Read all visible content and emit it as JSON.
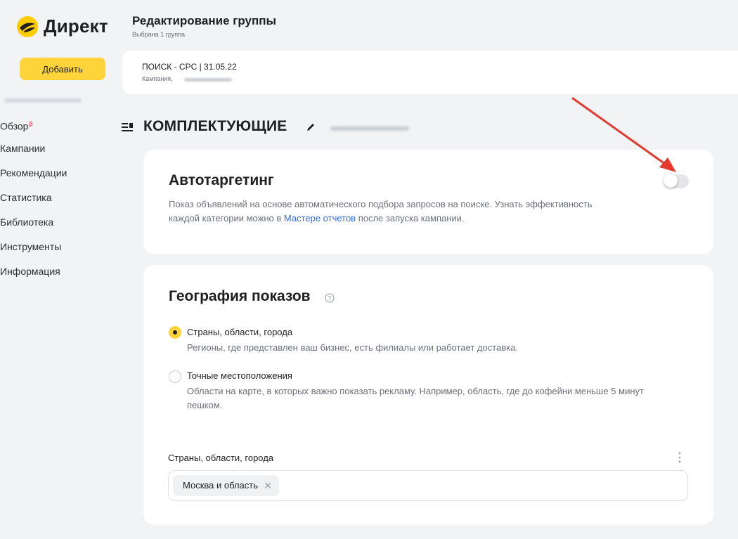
{
  "brand": {
    "name": "Директ",
    "accent": "#ffd43b",
    "logo_icon": "yandex-direct-logo-icon"
  },
  "sidebar": {
    "add_button": "Добавить",
    "items": [
      {
        "label": "Обзор",
        "badge": "β"
      },
      {
        "label": "Кампании"
      },
      {
        "label": "Рекомендации"
      },
      {
        "label": "Статистика"
      },
      {
        "label": "Библиотека"
      },
      {
        "label": "Инструменты"
      },
      {
        "label": "Информация"
      }
    ]
  },
  "header": {
    "title": "Редактирование группы",
    "subtitle": "Выбрана 1 группа"
  },
  "campaign": {
    "name": "ПОИСК - CPC | 31.05.22",
    "meta_label": "Кампания,"
  },
  "group": {
    "title": "КОМПЛЕКТУЮЩИЕ"
  },
  "autotargeting": {
    "title": "Автотаргетинг",
    "desc_part1": "Показ объявлений на основе автоматического подбора запросов на поиске. Узнать эффективность каждой категории можно в ",
    "link_text": "Мастере отчетов",
    "desc_part2": " после запуска кампании.",
    "enabled": false
  },
  "geography": {
    "title": "География показов",
    "options": [
      {
        "label": "Страны, области, города",
        "desc": "Регионы, где представлен ваш бизнес, есть филиалы или работает доставка.",
        "selected": true
      },
      {
        "label": "Точные местоположения",
        "desc": "Области на карте, в которых важно показать рекламу. Например, область, где до кофейни меньше 5 минут пешком.",
        "selected": false
      }
    ],
    "field_label": "Страны, области, города",
    "chips": [
      "Москва и область"
    ]
  },
  "colors": {
    "accent": "#ffd43b",
    "link": "#2f6ee0",
    "annotation_arrow": "#e53a2f",
    "background": "#f2f3f5"
  }
}
